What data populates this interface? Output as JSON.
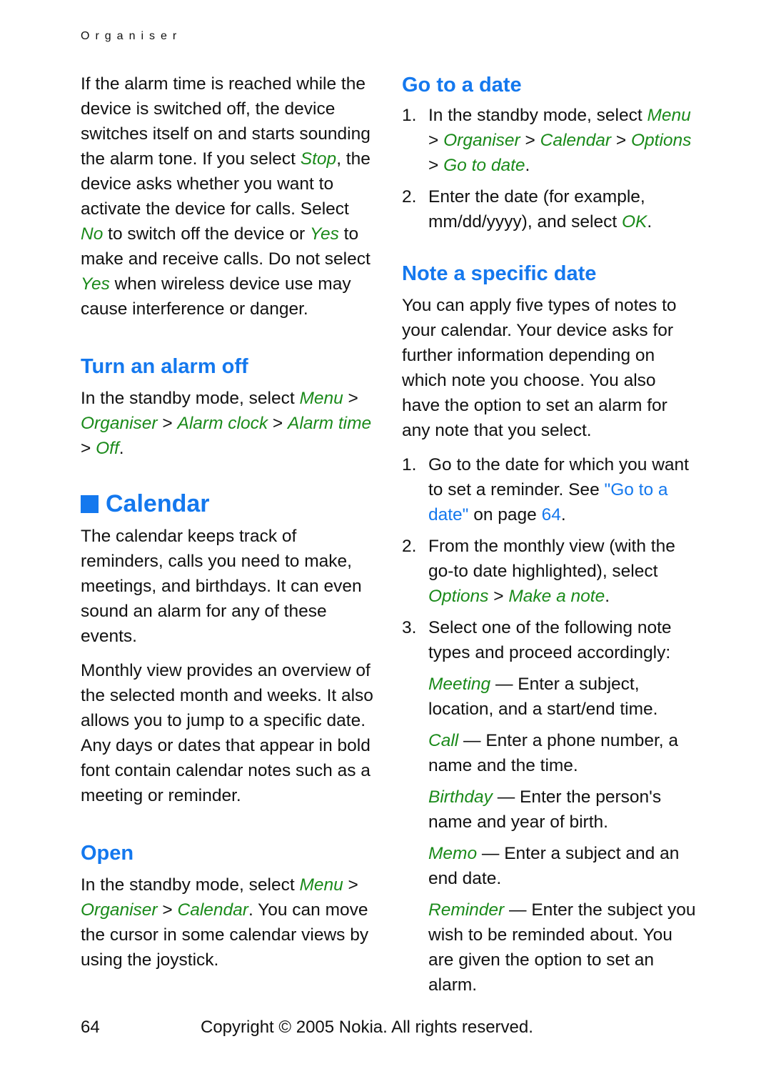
{
  "header": {
    "section": "Organiser"
  },
  "left": {
    "intro": {
      "t1": "If the alarm time is reached while the device is switched off, the device switches itself on and starts sounding the alarm tone. If you select ",
      "stop": "Stop",
      "t2": ", the device asks whether you want to activate the device for calls. Select ",
      "no": "No",
      "t3": " to switch off the device or ",
      "yes1": "Yes",
      "t4": " to make and receive calls. Do not select ",
      "yes2": "Yes",
      "t5": " when wireless device use may cause interference or danger."
    },
    "alarm_off": {
      "heading": "Turn an alarm off",
      "t1": "In the standby mode, select ",
      "menu": "Menu",
      "sep": " > ",
      "organiser": "Organiser",
      "alarm_clock": "Alarm clock",
      "alarm_time": "Alarm time",
      "off": "Off",
      "end": "."
    },
    "calendar": {
      "heading": "Calendar",
      "p1": "The calendar keeps track of reminders, calls you need to make, meetings, and birthdays. It can even sound an alarm for any of these events.",
      "p2": "Monthly view provides an overview of the selected month and weeks. It also allows you to jump to a specific date. Any days or dates that appear in bold font contain calendar notes such as a meeting or reminder."
    },
    "open": {
      "heading": "Open",
      "t1": "In the standby mode, select ",
      "menu": "Menu",
      "sep": " > ",
      "organiser": "Organiser",
      "calendar": "Calendar",
      "t2": ". You can move the cursor in some calendar views by using the joystick."
    }
  },
  "right": {
    "goto": {
      "heading": "Go to a date",
      "step1_num": "1.",
      "step1_t": "In the standby mode, select ",
      "menu": "Menu",
      "sep": " > ",
      "organiser": "Organiser",
      "calendar": "Calendar",
      "options": "Options",
      "go_to_date": "Go to date",
      "end": ".",
      "step2_num": "2.",
      "step2_t": "Enter the date (for example, mm/dd/yyyy), and select ",
      "ok": "OK"
    },
    "note": {
      "heading": "Note a specific date",
      "intro": "You can apply five types of notes to your calendar. Your device asks for further information depending on which note you choose. You also have the option to set an alarm for any note that you select.",
      "s1_num": "1.",
      "s1_t": "Go to the date for which you want to set a reminder. See ",
      "s1_link": "\"Go to a date\"",
      "s1_t2": " on page ",
      "s1_page": "64",
      "s2_num": "2.",
      "s2_t": "From the monthly view (with the go-to date highlighted), select ",
      "options": "Options",
      "make_note": "Make a note",
      "s3_num": "3.",
      "s3_t": "Select one of the following note types and proceed accordingly:",
      "types": [
        {
          "name": "Meeting",
          "desc": " — Enter a subject, location, and a start/end time."
        },
        {
          "name": "Call",
          "desc": " — Enter a phone number, a name and the time."
        },
        {
          "name": "Birthday",
          "desc": " — Enter the person's name and year of birth."
        },
        {
          "name": "Memo",
          "desc": " — Enter a subject and an end date."
        },
        {
          "name": "Reminder",
          "desc": " — Enter the subject you wish to be reminded about. You are given the option to set an alarm."
        }
      ]
    }
  },
  "footer": {
    "page": "64",
    "copyright": "Copyright © 2005 Nokia. All rights reserved."
  }
}
